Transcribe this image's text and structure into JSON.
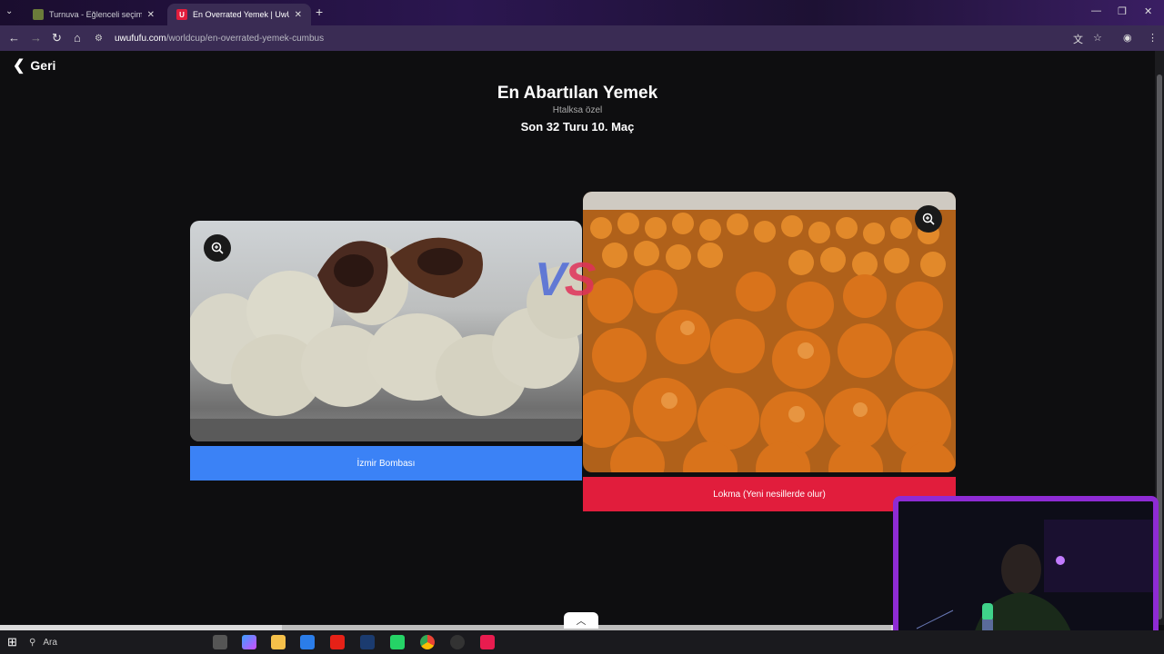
{
  "browser": {
    "tabs": [
      {
        "title": "Turnuva - Eğlenceli seçimler yap",
        "active": false
      },
      {
        "title": "En Overrated Yemek | UwUFUFU",
        "active": true,
        "favicon": "U"
      }
    ],
    "url_host": "uwufufu.com",
    "url_path": "/worldcup/en-overrated-yemek-cumbus"
  },
  "page": {
    "back_label": "Geri",
    "title": "En Abartılan Yemek",
    "subtitle": "Htalksa özel",
    "round": "Son 32 Turu 10. Maç",
    "vs_v": "V",
    "vs_s": "S"
  },
  "left_choice": {
    "label": "İzmir Bombası",
    "button_color": "#3b82f6"
  },
  "right_choice": {
    "label": "Lokma (Yeni nesillerde olur)",
    "button_color": "#e11d3c"
  },
  "taskbar": {
    "search_placeholder": "Ara"
  },
  "colors": {
    "webcam_border": "#8e2bd4",
    "toolbar_bg": "#3a2c54"
  }
}
